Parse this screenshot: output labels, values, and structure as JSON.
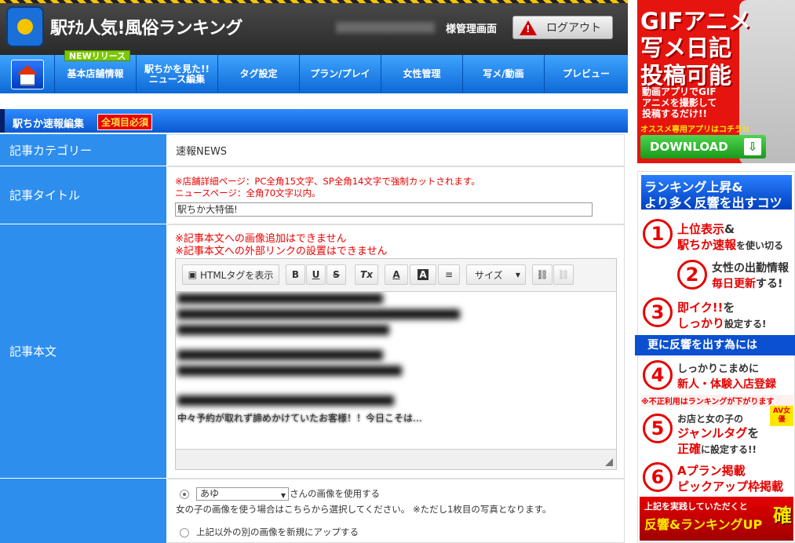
{
  "header": {
    "logo_text": "駅ﾁｶ人気!風俗ランキング",
    "admin_label": "様管理画面",
    "logout_label": "ログアウト"
  },
  "nav": {
    "new_badge": "NEWリリース",
    "items": [
      "基本店舗情報",
      "駅ちかを見た!!\nニュース編集",
      "タグ設定",
      "プラン/プレイ",
      "女性管理",
      "写メ/動画",
      "プレビュー"
    ]
  },
  "section": {
    "title": "駅ちか速報編集",
    "required": "全項目必須"
  },
  "form": {
    "category": {
      "label": "記事カテゴリー",
      "value": "速報NEWS"
    },
    "title": {
      "label": "記事タイトル",
      "note1": "※店舗詳細ページ：PC全角15文字、SP全角14文字で強制カットされます。",
      "note2": "ニュースページ：全角70文字以内。",
      "value": "駅ちか大特価!"
    },
    "body": {
      "label": "記事本文",
      "note1": "※記事本文への画像追加はできません",
      "note2": "※記事本文への外部リンクの設置はできません",
      "tail_text": "中々予約が取れず諦めかけていたお客様！！今日こそは…"
    },
    "toolbar": {
      "html_label": "HTMLタグを表示",
      "bold": "B",
      "underline": "U",
      "strike": "S",
      "clear": "Tx",
      "font_color": "A",
      "bg_color": "A",
      "size_label": "サイズ"
    },
    "image": {
      "selected_girl": "あゆ",
      "use_suffix": "さんの画像を使用する",
      "note": "女の子の画像を使う場合はこちらから選択してください。 ※ただし1枚目の写真となります。",
      "other_label": "上記以外の別の画像を新規にアップする"
    }
  },
  "ads": {
    "gif": {
      "line1": "GIFアニメ",
      "line2": "写メ日記",
      "line3": "投稿可能",
      "desc": "動画アプリでGIF\nアニメを撮影して\n投稿するだけ!!",
      "recommend": "オススメ専用アプリはコチラ!!",
      "download": "DOWNLOAD"
    },
    "ranking": {
      "head1": "ランキング上昇&",
      "head2": "より多く反響を出すコツ",
      "tip1a": "上位表示",
      "tip1b": "&",
      "tip1c": "駅ちか速報",
      "tip1d": "を使い切る",
      "tip2a": "女性の出勤情報",
      "tip2b": "毎日更新",
      "tip2c": "する!",
      "tip3a": "即イク!!",
      "tip3b": "を",
      "tip3c": "しっかり",
      "tip3d": "設定する!",
      "banner": "更に反響を出す為には",
      "tip4a": "しっかりこまめに",
      "tip4b": "新人・体験入店登録",
      "warn": "※不正利用はランキングが下がります",
      "tip5a": "お店と女の子の",
      "tip5b": "ジャンルタグ",
      "tip5c": "を",
      "tip5d": "正確",
      "tip5e": "に設定する!!",
      "tip6a": "Aプラン掲載",
      "tip6b": "ピックアップ枠掲載",
      "foot1": "上記を実践していただくと",
      "foot2": "反響&ランキングUP",
      "badge": "確",
      "av_badge": "AV女優"
    }
  }
}
